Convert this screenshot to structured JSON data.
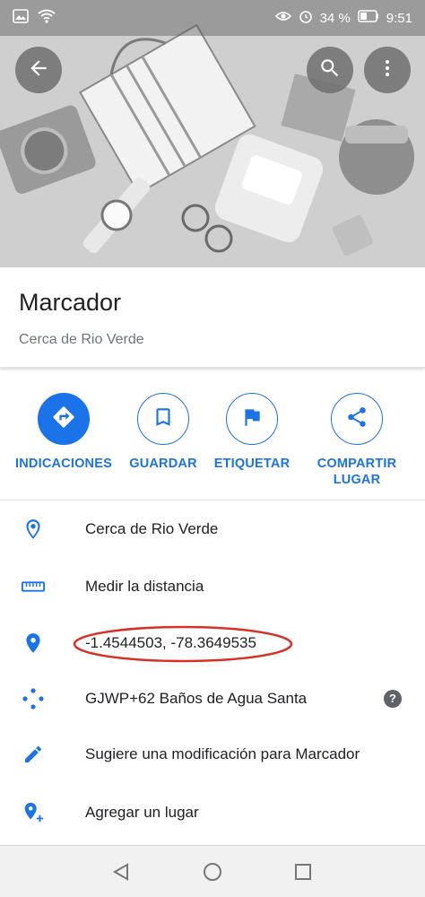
{
  "status_bar": {
    "battery": "34 %",
    "time": "9:51"
  },
  "header": {
    "back_icon": "arrow-back-icon",
    "search_icon": "search-icon",
    "more_icon": "more-vert-icon"
  },
  "place": {
    "title": "Marcador",
    "subtitle": "Cerca de Rio Verde"
  },
  "actions": [
    {
      "label": "INDICACIONES",
      "icon": "directions-icon"
    },
    {
      "label": "GUARDAR",
      "icon": "bookmark-icon"
    },
    {
      "label": "ETIQUETAR",
      "icon": "flag-icon"
    },
    {
      "label": "COMPARTIR LUGAR",
      "icon": "share-icon"
    }
  ],
  "details": {
    "address": "Cerca de Rio Verde",
    "measure": "Medir la distancia",
    "coordinates": "-1.4544503, -78.3649535",
    "plus_code": "GJWP+62 Baños de Agua Santa",
    "suggest": "Sugiere una modificación para Marcador",
    "add_place": "Agregar un lugar"
  },
  "colors": {
    "accent": "#1a73e8",
    "annotation": "#d93025"
  }
}
